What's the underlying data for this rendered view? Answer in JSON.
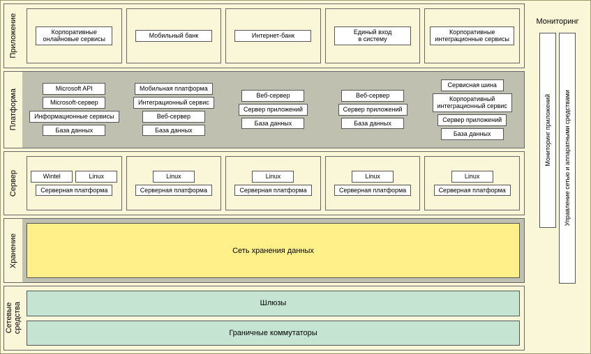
{
  "rows": {
    "app": {
      "label": "Приложение",
      "cols": [
        {
          "items": [
            "Корпоративные\nонлайновые сервисы"
          ]
        },
        {
          "items": [
            "Мобильный банк"
          ]
        },
        {
          "items": [
            "Интернет-банк"
          ]
        },
        {
          "items": [
            "Единый вход\nв систему"
          ]
        },
        {
          "items": [
            "Корпоративные\nинтеграционные сервисы"
          ]
        }
      ]
    },
    "platform": {
      "label": "Платформа",
      "cols": [
        {
          "items": [
            "Microsoft API",
            "Microsoft-сервер",
            "Информационные сервисы",
            "База данных"
          ]
        },
        {
          "items": [
            "Мобильная платформа",
            "Интеграционный сервис",
            "Веб-сервер",
            "База данных"
          ]
        },
        {
          "items": [
            "Веб-сервер",
            "Сервер приложений",
            "База данных"
          ]
        },
        {
          "items": [
            "Веб-сервер",
            "Сервер приложений",
            "База данных"
          ]
        },
        {
          "items": [
            "Сервисная шина",
            "Корпоративный\nинтеграционный сервис",
            "Сервер приложений",
            "База данных"
          ]
        }
      ]
    },
    "server": {
      "label": "Сервер",
      "cols": [
        {
          "os": [
            "Wintel",
            "Linux"
          ],
          "platform": "Серверная платформа"
        },
        {
          "os": [
            "Linux"
          ],
          "platform": "Серверная платформа"
        },
        {
          "os": [
            "Linux"
          ],
          "platform": "Серверная платформа"
        },
        {
          "os": [
            "Linux"
          ],
          "platform": "Серверная платформа"
        },
        {
          "os": [
            "Linux"
          ],
          "platform": "Серверная платформа"
        }
      ]
    },
    "storage": {
      "label": "Хранение",
      "bar": "Сеть хранения данных"
    },
    "network": {
      "label": "Сетевые\nсредства",
      "bars": [
        "Шлюзы",
        "Граничные коммутаторы"
      ]
    }
  },
  "monitoring": {
    "title": "Мониторинг",
    "bars": [
      "Мониторинг приложений",
      "Управление сетью и аппаратными средствами"
    ]
  }
}
